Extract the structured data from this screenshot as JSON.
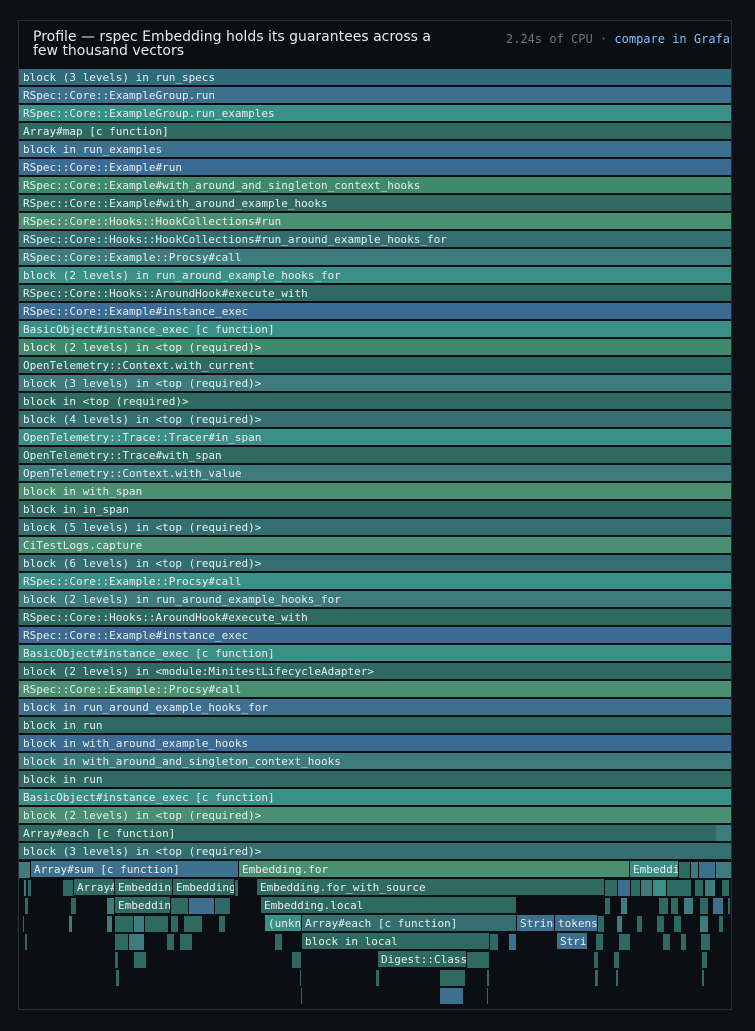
{
  "header": {
    "title": "Profile — rspec Embedding holds its guarantees across a few thousand vectors",
    "cpu": "2.24s of CPU",
    "separator": "·",
    "compare_link": "compare in Grafana"
  },
  "stack_rows": [
    "block (3 levels) in run_specs",
    "RSpec::Core::ExampleGroup.run",
    "RSpec::Core::ExampleGroup.run_examples",
    "Array#map [c function]",
    "block in run_examples",
    "RSpec::Core::Example#run",
    "RSpec::Core::Example#with_around_and_singleton_context_hooks",
    "RSpec::Core::Example#with_around_example_hooks",
    "RSpec::Core::Hooks::HookCollections#run",
    "RSpec::Core::Hooks::HookCollections#run_around_example_hooks_for",
    "RSpec::Core::Example::Procsy#call",
    "block (2 levels) in run_around_example_hooks_for",
    "RSpec::Core::Hooks::AroundHook#execute_with",
    "RSpec::Core::Example#instance_exec",
    "BasicObject#instance_exec [c function]",
    "block (2 levels) in <top (required)>",
    "OpenTelemetry::Context.with_current",
    "block (3 levels) in <top (required)>",
    "block in <top (required)>",
    "block (4 levels) in <top (required)>",
    "OpenTelemetry::Trace::Tracer#in_span",
    "OpenTelemetry::Trace#with_span",
    "OpenTelemetry::Context.with_value",
    "block in with_span",
    "block in in_span",
    "block (5 levels) in <top (required)>",
    "CiTestLogs.capture",
    "block (6 levels) in <top (required)>",
    "RSpec::Core::Example::Procsy#call",
    "block (2 levels) in run_around_example_hooks_for",
    "RSpec::Core::Hooks::AroundHook#execute_with",
    "RSpec::Core::Example#instance_exec",
    "BasicObject#instance_exec [c function]",
    "block (2 levels) in <module:MinitestLifecycleAdapter>",
    "RSpec::Core::Example::Procsy#call",
    "block in run_around_example_hooks_for",
    "block in run",
    "block in with_around_example_hooks",
    "block in with_around_and_singleton_context_hooks",
    "block in run",
    "BasicObject#instance_exec [c function]",
    "block (2 levels) in <top (required)>",
    "Array#each [c function]",
    "block (3 levels) in <top (required)>"
  ],
  "leaf_frames": [
    "Array#sum [c function]",
    "Embedding.for",
    "Embedding",
    "Array#each [c function]",
    "Embedding",
    "Embedding",
    "Embedding.for_with_source",
    "Embedding",
    "Embedding.local",
    "(unknown)",
    "Array#each [c function]",
    "String",
    "tokens",
    "block in local",
    "String",
    "Digest::Class"
  ],
  "colors": {
    "background": "#0d1117",
    "panel": "#0b0f14",
    "title_text": "#e6edf3",
    "meta_text": "#6e7681",
    "link": "#79c0ff",
    "frame_palette": [
      "#2f6b7a",
      "#3d6f8f",
      "#3a8f86",
      "#2e6a62",
      "#3b6a92",
      "#3e7b7c",
      "#3f8a6c",
      "#336f70",
      "#4a8f71",
      "#3f6f93"
    ]
  }
}
